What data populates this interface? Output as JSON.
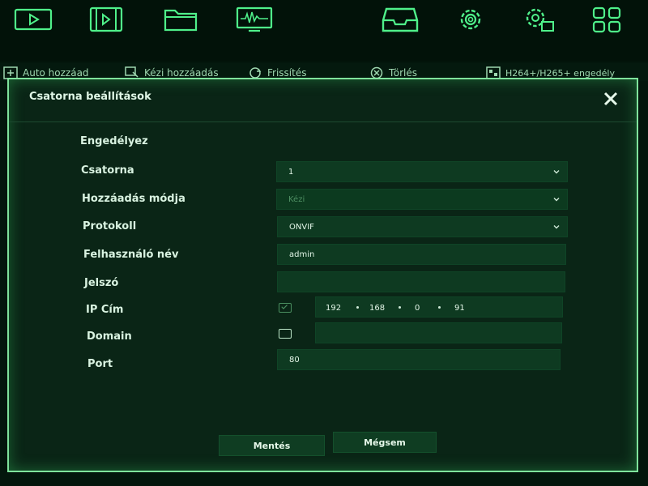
{
  "top_icons": [
    "play-icon",
    "video-film-icon",
    "folder-icon",
    "monitor-waveform-icon",
    "inbox-tray-icon",
    "gear-icon",
    "system-settings-icon",
    "grid-apps-icon"
  ],
  "toolbar": {
    "auto_add": "Auto hozzáad",
    "manual_add": "Kézi hozzáadás",
    "refresh": "Frissítés",
    "delete": "Törlés",
    "h264": "H264+/H265+ engedély"
  },
  "dialog": {
    "title": "Csatorna beállítások",
    "enable_label": "Engedélyez",
    "channel_label": "Csatorna",
    "channel_value": "1",
    "add_mode_label": "Hozzáadás módja",
    "add_mode_value": "Kézi",
    "protocol_label": "Protokoll",
    "protocol_value": "ONVIF",
    "username_label": "Felhasználó név",
    "username_value": "admin",
    "password_label": "Jelszó",
    "password_value": "",
    "ip_label": "IP Cím",
    "ip": [
      "192",
      "168",
      "0",
      "91"
    ],
    "ip_checked": true,
    "domain_label": "Domain",
    "domain_checked": false,
    "domain_value": "",
    "port_label": "Port",
    "port_value": "80",
    "save": "Mentés",
    "cancel": "Mégsem"
  },
  "colors": {
    "accent": "#7fe39c",
    "background": "#0a2516",
    "field": "#0e3a21"
  }
}
